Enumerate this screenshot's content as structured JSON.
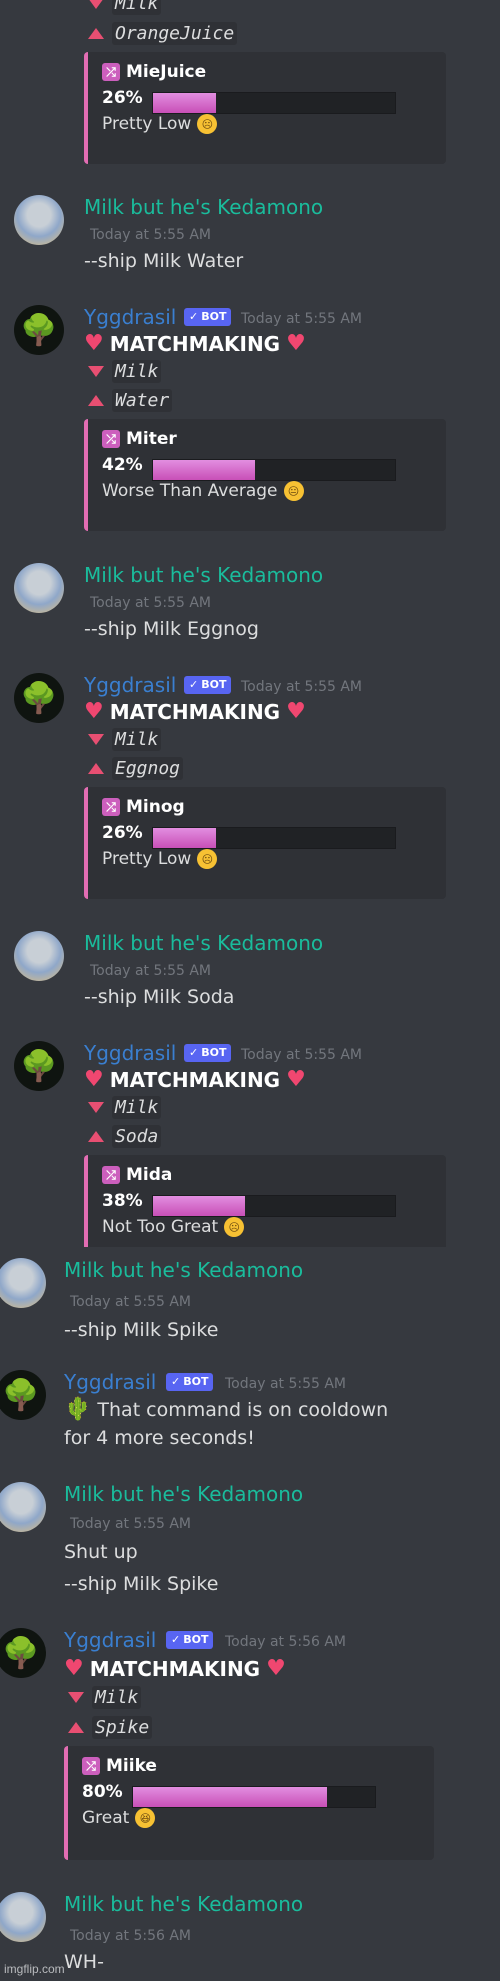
{
  "colors": {
    "background": "#36393f",
    "user_name": "#1abc9c",
    "bot_name": "#3a7fd0",
    "embed_accent": "#e26db3",
    "heart": "#f04770"
  },
  "top_fragment": {
    "down_item": "Milk",
    "up_item": "OrangeJuice",
    "embed": {
      "name": "MieJuice",
      "percent": "26%",
      "fill": 0.26,
      "verdict": "Pretty Low",
      "emoji": "slightly-frowning"
    }
  },
  "messages": [
    {
      "author": "Milk but he's Kedamono",
      "time": "Today at 5:55 AM",
      "lines": [
        "--ship Milk Water"
      ]
    },
    {
      "author": "Yggdrasil",
      "badge": "BOT",
      "time": "Today at 5:55 AM",
      "title": "MATCHMAKING",
      "down_item": "Milk",
      "up_item": "Water",
      "embed": {
        "name": "Miter",
        "percent": "42%",
        "fill": 0.42,
        "verdict": "Worse Than Average",
        "emoji": "neutral-face"
      }
    },
    {
      "author": "Milk but he's Kedamono",
      "time": "Today at 5:55 AM",
      "lines": [
        "--ship Milk Eggnog"
      ]
    },
    {
      "author": "Yggdrasil",
      "badge": "BOT",
      "time": "Today at 5:55 AM",
      "title": "MATCHMAKING",
      "down_item": "Milk",
      "up_item": "Eggnog",
      "embed": {
        "name": "Minog",
        "percent": "26%",
        "fill": 0.26,
        "verdict": "Pretty Low",
        "emoji": "slightly-frowning"
      }
    },
    {
      "author": "Milk but he's Kedamono",
      "time": "Today at 5:55 AM",
      "lines": [
        "--ship Milk Soda"
      ]
    },
    {
      "author": "Yggdrasil",
      "badge": "BOT",
      "time": "Today at 5:55 AM",
      "title": "MATCHMAKING",
      "down_item": "Milk",
      "up_item": "Soda",
      "embed": {
        "name": "Mida",
        "percent": "38%",
        "fill": 0.38,
        "verdict": "Not Too Great",
        "emoji": "slightly-frowning"
      }
    },
    {
      "author": "Milk but he's Kedamono",
      "time": "Today at 5:55 AM",
      "lines": [
        "--ship Milk Spike"
      ]
    },
    {
      "author": "Yggdrasil",
      "badge": "BOT",
      "time": "Today at 5:55 AM",
      "lines": [
        "That command is on cooldown",
        "for 4 more seconds!"
      ],
      "icon": "cactus-icon"
    },
    {
      "author": "Milk but he's Kedamono",
      "time": "Today at 5:55 AM",
      "lines": [
        "Shut up",
        "--ship Milk Spike"
      ]
    },
    {
      "author": "Yggdrasil",
      "badge": "BOT",
      "time": "Today at 5:56 AM",
      "title": "MATCHMAKING",
      "down_item": "Milk",
      "up_item": "Spike",
      "embed": {
        "name": "Miike",
        "percent": "80%",
        "fill": 0.8,
        "verdict": "Great",
        "emoji": "grinning-squinting"
      }
    },
    {
      "author": "Milk but he's Kedamono",
      "time": "Today at 5:56 AM",
      "lines": [
        "WH-"
      ]
    }
  ],
  "watermark": "imgflip.com"
}
